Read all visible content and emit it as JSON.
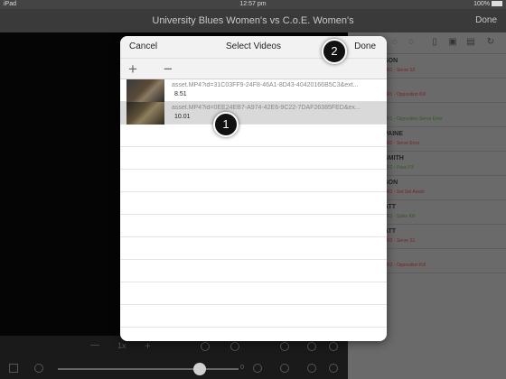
{
  "status_bar": {
    "device": "iPad",
    "time": "12:57 pm",
    "battery": "100%"
  },
  "nav": {
    "title": "University Blues Women's vs C.o.E. Women's",
    "done_label": "Done"
  },
  "modal": {
    "cancel_label": "Cancel",
    "title": "Select Videos",
    "done_label": "Done",
    "add_label": "+",
    "remove_label": "−",
    "videos": [
      {
        "name": "asset.MP4?id=31C03FF9-24F8-46A1-8D43-40420166B5C3&ext...",
        "duration": "8.51",
        "selected": false
      },
      {
        "name": "asset.MP4?id=0EE24EB7-A974-42E6-9C22-7DAF26385FED&ex...",
        "duration": "10.01",
        "selected": true
      }
    ]
  },
  "events": [
    {
      "who": "SON",
      "what": "- R1 - Serve S2",
      "color": "red"
    },
    {
      "who": "",
      "what": "- R1 - Opposition Kill",
      "color": "red"
    },
    {
      "who": "",
      "what": "- R1 - Opposition Serve Error",
      "color": "green"
    },
    {
      "who": "PAINE",
      "what": "- R2 - Serve Error",
      "color": "red"
    },
    {
      "who": "SMITH",
      "what": "- R2 - Pass P3",
      "color": "green"
    },
    {
      "who": "SON",
      "what": "- R2 - Set Set Assist",
      "color": "red"
    },
    {
      "who": "ATT",
      "what": "- R2 - Spike Kill",
      "color": "green"
    },
    {
      "who": "ATT",
      "what": "- R3 - Serve S1",
      "color": "red"
    },
    {
      "who": "",
      "what": "- R3 - Opposition Kill",
      "color": "red"
    }
  ],
  "controls": {
    "speed": "1x",
    "minus": "—",
    "plus": "+",
    "time": "0"
  },
  "callouts": {
    "one": "1",
    "two": "2"
  },
  "colors": {
    "modal_bg": "#ffffff",
    "selected_row": "#d9d9d9",
    "header_bg": "#f2f2f2"
  }
}
